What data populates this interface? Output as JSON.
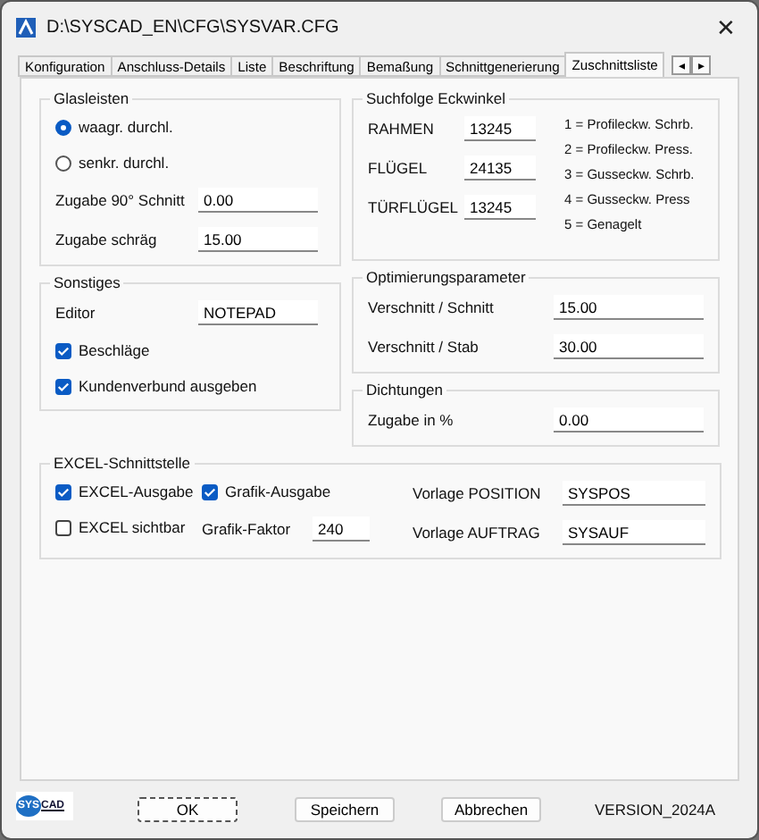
{
  "window": {
    "title": "D:\\SYSCAD_EN\\CFG\\SYSVAR.CFG",
    "close": "✕"
  },
  "tabs": [
    {
      "label": "Konfiguration",
      "selected": false
    },
    {
      "label": "Anschluss-Details",
      "selected": false
    },
    {
      "label": "Liste",
      "selected": false
    },
    {
      "label": "Beschriftung",
      "selected": false
    },
    {
      "label": "Bemaßung",
      "selected": false
    },
    {
      "label": "Schnittgenerierung",
      "selected": false
    },
    {
      "label": "Zuschnittsliste",
      "selected": true
    }
  ],
  "tab_scroll": [
    "◂",
    "▸"
  ],
  "glasleisten": {
    "title": "Glasleisten",
    "options": [
      {
        "label": "waagr. durchl.",
        "selected": true
      },
      {
        "label": "senkr. durchl.",
        "selected": false
      }
    ],
    "fields": [
      {
        "label": "Zugabe 90° Schnitt",
        "value": "0.00"
      },
      {
        "label": "Zugabe schräg",
        "value": "15.00"
      }
    ]
  },
  "sonstiges": {
    "title": "Sonstiges",
    "editor_label": "Editor",
    "editor_value": "NOTEPAD",
    "checkboxes": [
      {
        "label": "Beschläge",
        "checked": true
      },
      {
        "label": "Kundenverbund ausgeben",
        "checked": true
      }
    ]
  },
  "suchfolge": {
    "title": "Suchfolge Eckwinkel",
    "fields": [
      {
        "label": "RAHMEN",
        "value": "13245"
      },
      {
        "label": "FLÜGEL",
        "value": "24135"
      },
      {
        "label": "TÜRFLÜGEL",
        "value": "13245"
      }
    ],
    "legend": [
      "1 = Profileckw. Schrb.",
      "2 = Profileckw. Press.",
      "3 = Gusseckw. Schrb.",
      "4 = Gusseckw. Press",
      "5 = Genagelt"
    ]
  },
  "optimierung": {
    "title": "Optimierungsparameter",
    "fields": [
      {
        "label": "Verschnitt / Schnitt",
        "value": "15.00"
      },
      {
        "label": "Verschnitt / Stab",
        "value": "30.00"
      }
    ]
  },
  "dichtungen": {
    "title": "Dichtungen",
    "fields": [
      {
        "label": "Zugabe in %",
        "value": "0.00"
      }
    ]
  },
  "excel": {
    "title": "EXCEL-Schnittstelle",
    "checkboxes": [
      {
        "label": "EXCEL-Ausgabe",
        "checked": true
      },
      {
        "label": "Grafik-Ausgabe",
        "checked": true
      },
      {
        "label": "EXCEL sichtbar",
        "checked": false
      }
    ],
    "faktor_label": "Grafik-Faktor",
    "faktor_value": "240",
    "fields": [
      {
        "label": "Vorlage POSITION",
        "value": "SYSPOS"
      },
      {
        "label": "Vorlage AUFTRAG",
        "value": "SYSAUF"
      }
    ]
  },
  "footer": {
    "logo": [
      "SYS",
      "CAD"
    ],
    "buttons": [
      {
        "label": "OK",
        "focused": true
      },
      {
        "label": "Speichern",
        "focused": false
      },
      {
        "label": "Abbrechen",
        "focused": false
      }
    ],
    "version": "VERSION_2024A"
  }
}
